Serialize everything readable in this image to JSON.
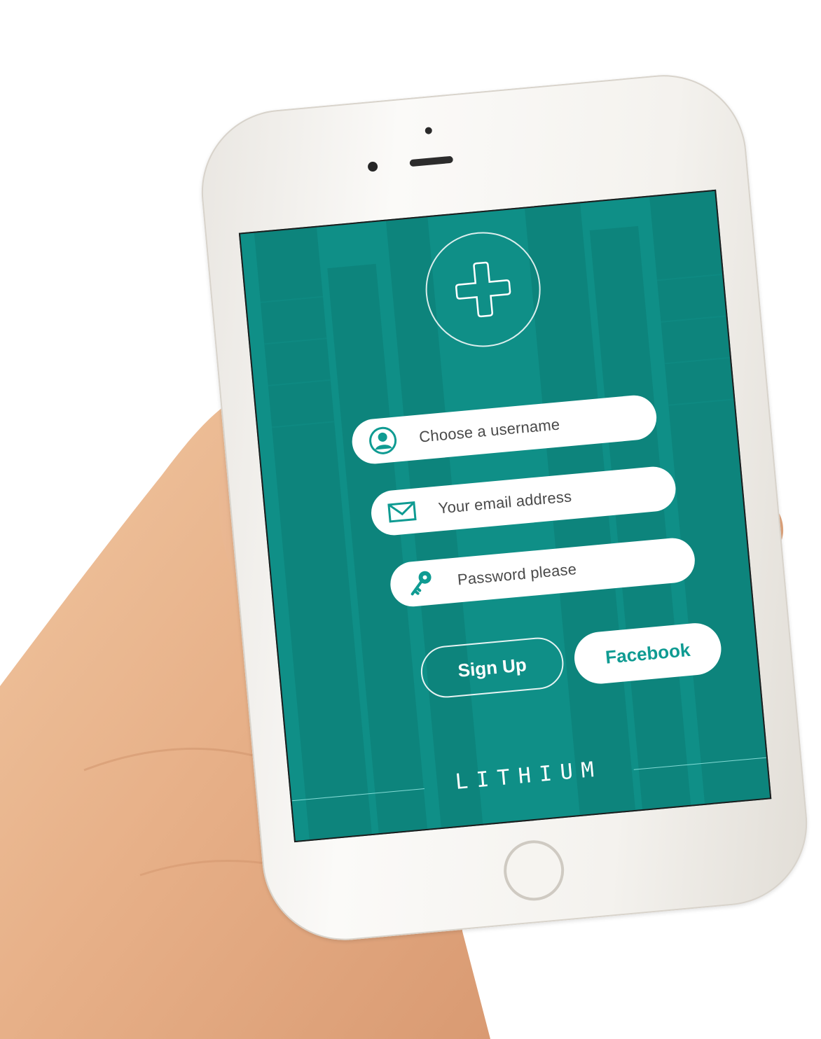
{
  "app": {
    "brand": "LITHIUM",
    "accent_color": "#0f8f87",
    "logo_icon": "plus-icon"
  },
  "form": {
    "username": {
      "placeholder": "Choose a username",
      "icon": "user-icon"
    },
    "email": {
      "placeholder": "Your email address",
      "icon": "mail-icon"
    },
    "password": {
      "placeholder": "Password please",
      "icon": "key-icon"
    }
  },
  "actions": {
    "signup_label": "Sign Up",
    "facebook_label": "Facebook"
  }
}
